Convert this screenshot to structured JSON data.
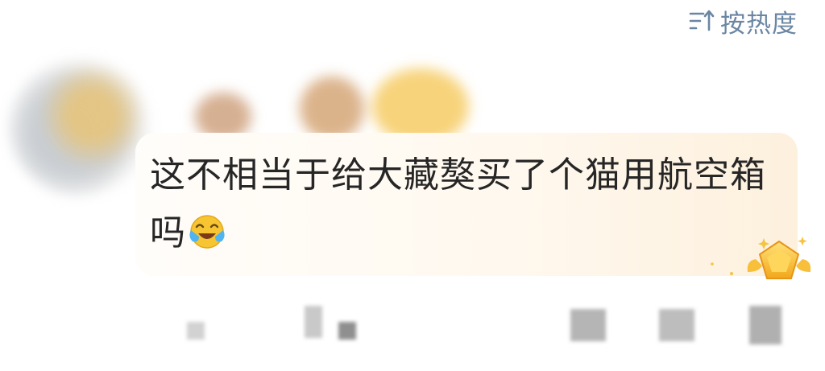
{
  "sort": {
    "label": "按热度",
    "icon": "sort-arrow-icon"
  },
  "comment": {
    "text": "这不相当于给大藏獒买了个猫用航空箱吗",
    "emoji": "laughing-crying-emoji",
    "badge": "crown-gem-badge-icon"
  },
  "colors": {
    "sort_accent": "#6b86a3",
    "comment_text": "#262626",
    "bubble_tint": "#fff8ee"
  }
}
